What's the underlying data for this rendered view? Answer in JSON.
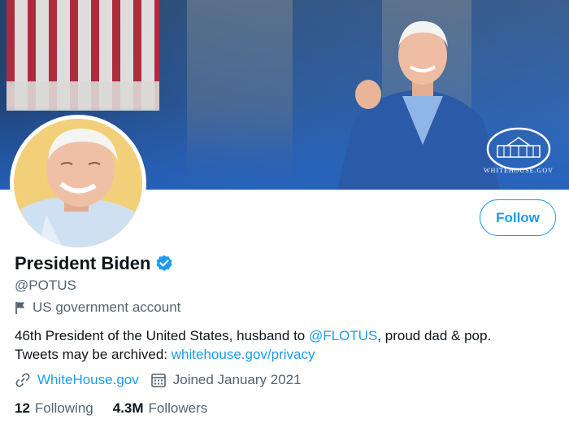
{
  "banner": {
    "logo_text": "WHITEHOUSE.GOV"
  },
  "profile": {
    "display_name": "President Biden",
    "handle": "@POTUS",
    "category": "US government account",
    "follow_label": "Follow"
  },
  "bio": {
    "line1_prefix": "46th President of the United States, husband to ",
    "mention": "@FLOTUS",
    "line1_suffix": ", proud dad & pop.",
    "line2_prefix": "Tweets may be archived: ",
    "archive_link": "whitehouse.gov/privacy"
  },
  "meta": {
    "website": "WhiteHouse.gov",
    "joined": "Joined January 2021"
  },
  "stats": {
    "following_count": "12",
    "following_label": "Following",
    "followers_count": "4.3M",
    "followers_label": "Followers"
  },
  "colors": {
    "accent": "#1d9bf0",
    "text_primary": "#0f1419",
    "text_secondary": "#536471",
    "banner_blue": "#2f6fcc"
  },
  "icons": [
    "verified-badge-icon",
    "flag-icon",
    "link-icon",
    "calendar-icon",
    "white-house-logo-icon"
  ]
}
